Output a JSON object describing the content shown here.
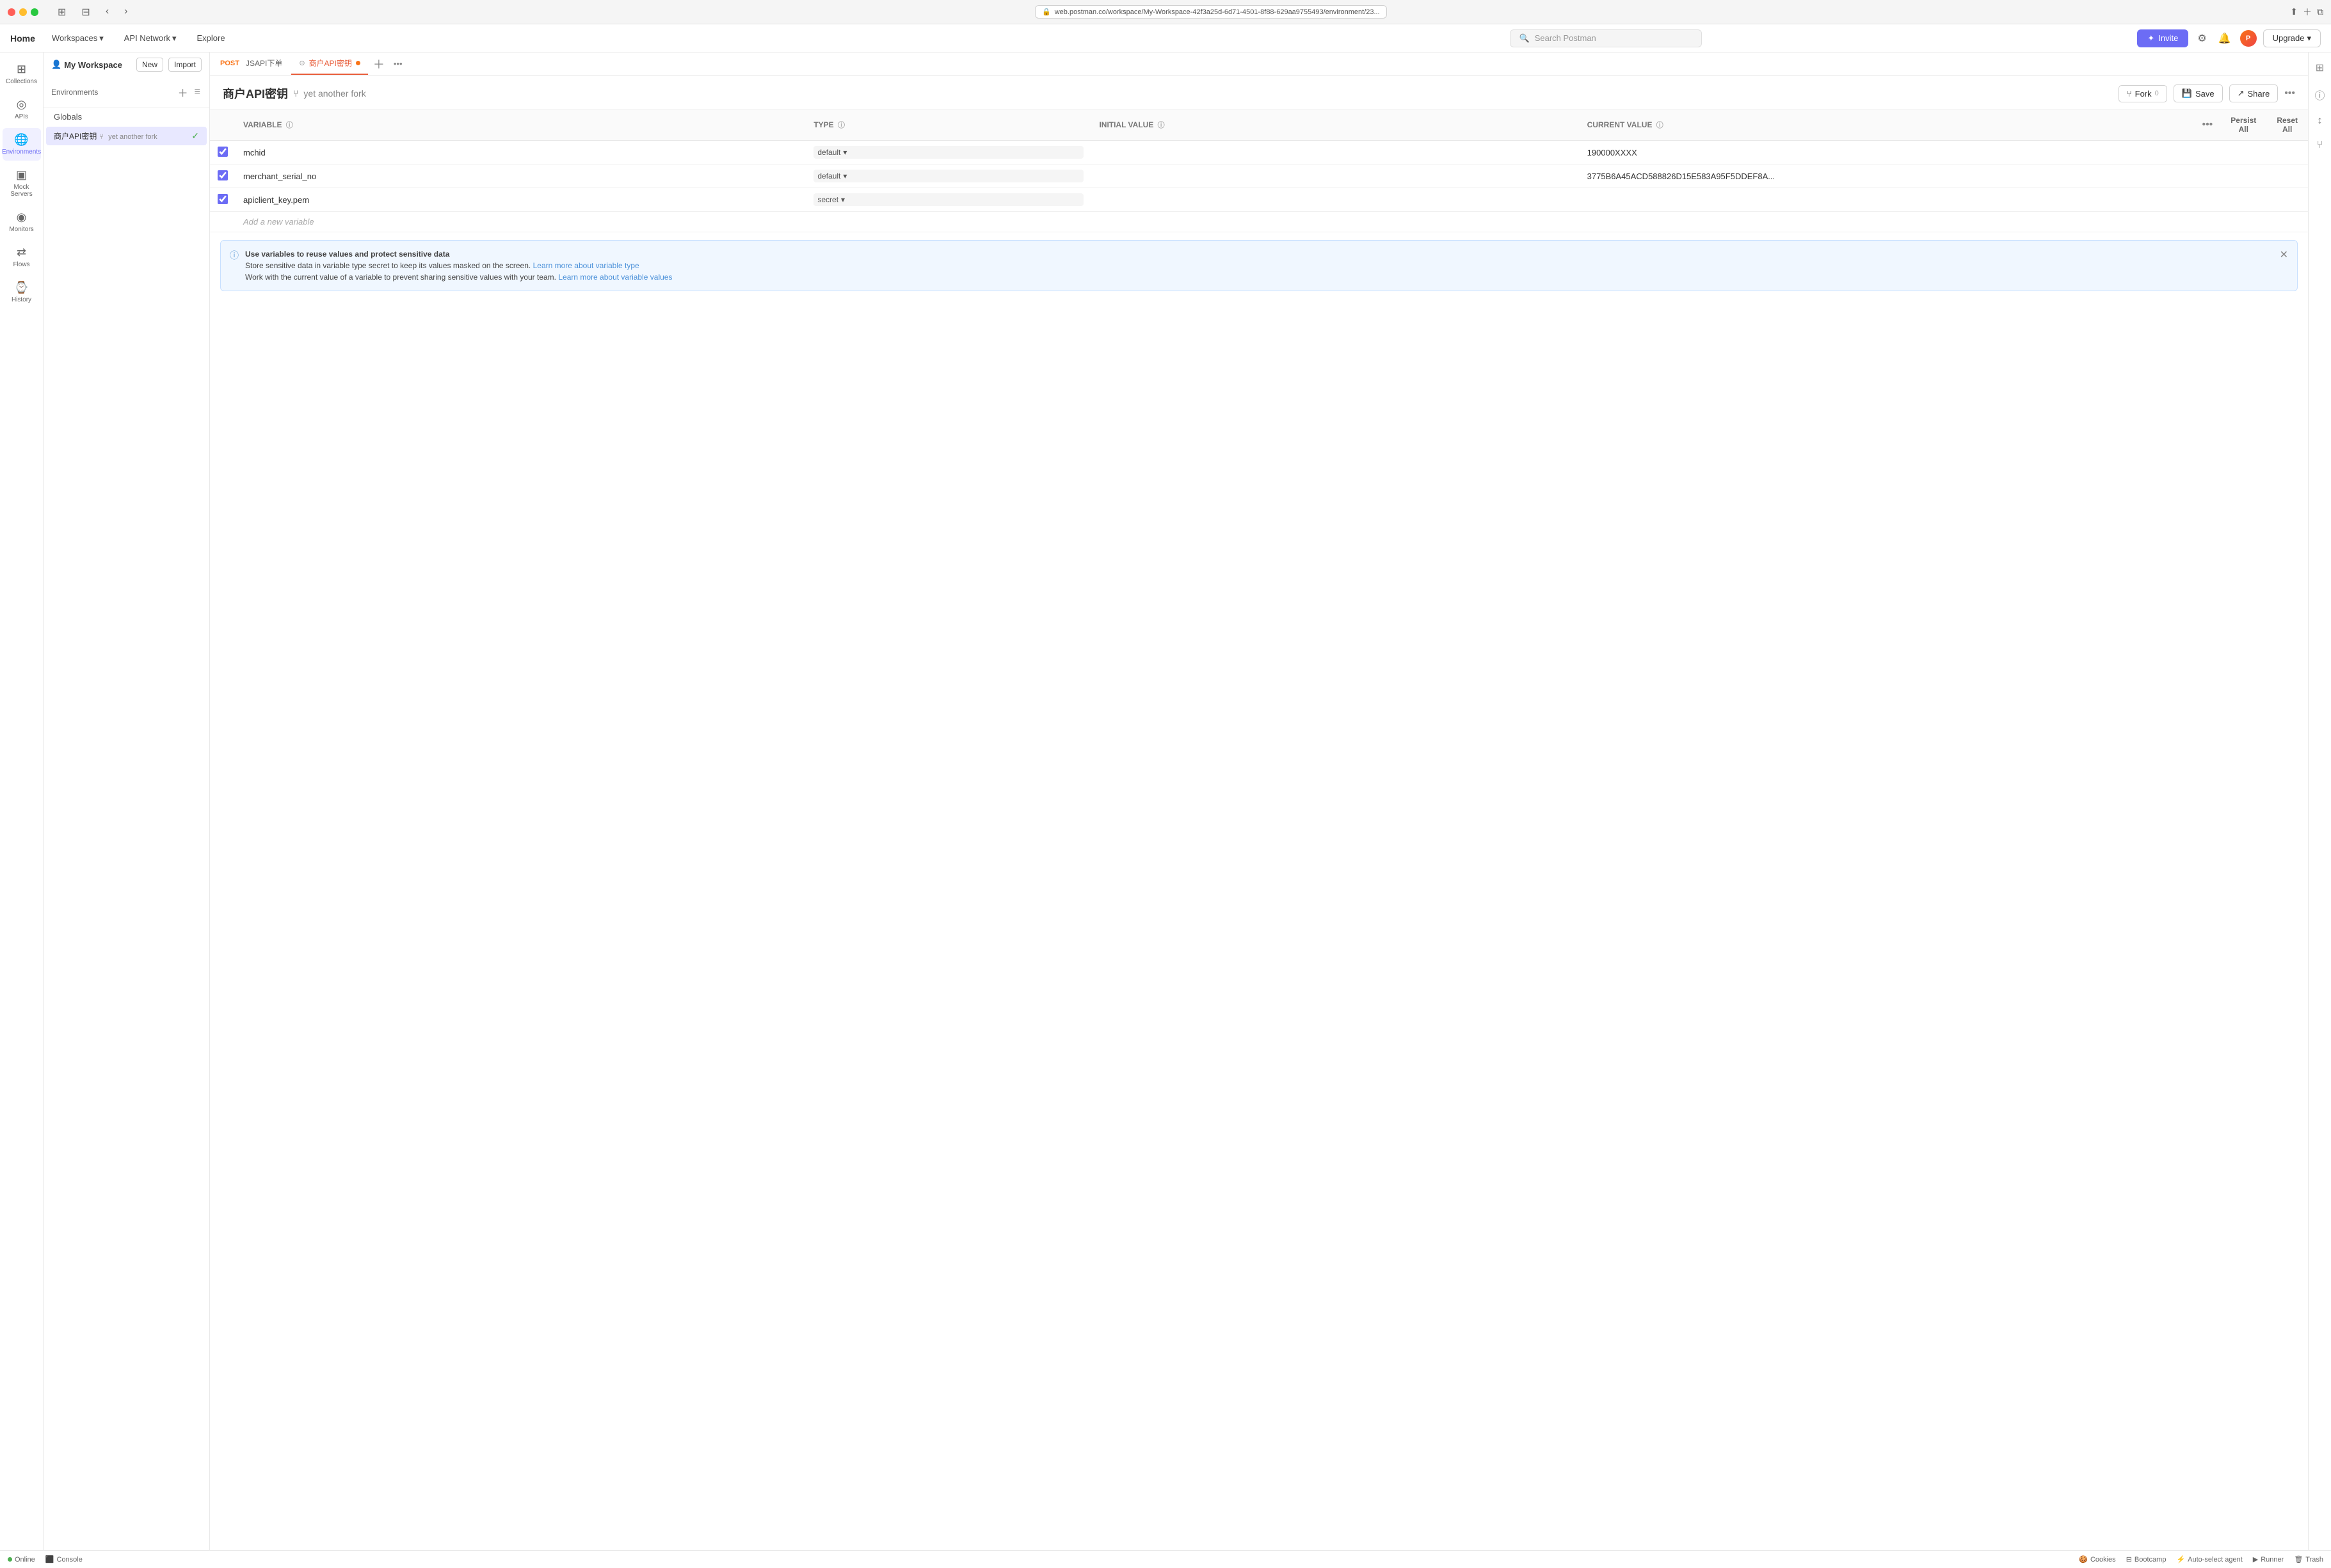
{
  "titlebar": {
    "url": "web.postman.co/workspace/My-Workspace-42f3a25d-6d71-4501-8f88-629aa9755493/environment/23...",
    "back_label": "‹",
    "forward_label": "›"
  },
  "navbar": {
    "home_label": "Home",
    "workspaces_label": "Workspaces",
    "api_network_label": "API Network",
    "explore_label": "Explore",
    "search_placeholder": "Search Postman",
    "invite_label": "Invite",
    "upgrade_label": "Upgrade"
  },
  "workspace": {
    "name": "My Workspace",
    "new_label": "New",
    "import_label": "Import"
  },
  "sidebar": {
    "items": [
      {
        "id": "collections",
        "label": "Collections",
        "icon": "⊞"
      },
      {
        "id": "apis",
        "label": "APIs",
        "icon": "◎"
      },
      {
        "id": "environments",
        "label": "Environments",
        "icon": "🌐"
      },
      {
        "id": "mock-servers",
        "label": "Mock Servers",
        "icon": "▣"
      },
      {
        "id": "monitors",
        "label": "Monitors",
        "icon": "◉"
      },
      {
        "id": "flows",
        "label": "Flows",
        "icon": "⇄"
      },
      {
        "id": "history",
        "label": "History",
        "icon": "⌚"
      }
    ]
  },
  "collections_panel": {
    "globals_label": "Globals",
    "env_name": "商户API密钥",
    "env_fork": "yet another fork",
    "env_checked": true
  },
  "tabs": [
    {
      "id": "jsapi",
      "method": "POST",
      "label": "JSAPI下单",
      "active": false
    },
    {
      "id": "env",
      "label": "商户API密钥",
      "active": true,
      "dot": true
    }
  ],
  "env_editor": {
    "title": "商户API密钥",
    "fork_label": "yet another fork",
    "fork_count": "0",
    "fork_btn": "Fork",
    "save_btn": "Save",
    "share_btn": "Share",
    "columns": {
      "variable": "VARIABLE",
      "type": "TYPE",
      "initial_value": "INITIAL VALUE",
      "current_value": "CURRENT VALUE",
      "persist_all": "Persist All",
      "reset_all": "Reset All"
    },
    "rows": [
      {
        "checked": true,
        "name": "mchid",
        "type": "default",
        "initial_value": "",
        "current_value": "190000XXXX"
      },
      {
        "checked": true,
        "name": "merchant_serial_no",
        "type": "default",
        "initial_value": "",
        "current_value": "3775B6A45ACD588826D15E583A95F5DDEF8A..."
      },
      {
        "checked": true,
        "name": "apiclient_key.pem",
        "type": "secret",
        "initial_value": "",
        "current_value": ""
      }
    ],
    "add_variable_placeholder": "Add a new variable"
  },
  "info_banner": {
    "text1": "Use variables to reuse values and protect sensitive data",
    "text2": "Store sensitive data in variable type secret to keep its values masked on the screen.",
    "link1_text": "Learn more about variable type",
    "link1_url": "#",
    "text3": "Work with the current value of a variable to prevent sharing sensitive values with your team.",
    "link2_text": "Learn more about variable values",
    "link2_url": "#"
  },
  "status_bar": {
    "online_label": "Online",
    "console_label": "Console",
    "auto_select_label": "Auto-select agent",
    "runner_label": "Runner",
    "trash_label": "Trash",
    "bootcamp_label": "Bootcamp",
    "cookies_label": "Cookies"
  },
  "env_header_title": "商户API密钥 [yet another fork]"
}
